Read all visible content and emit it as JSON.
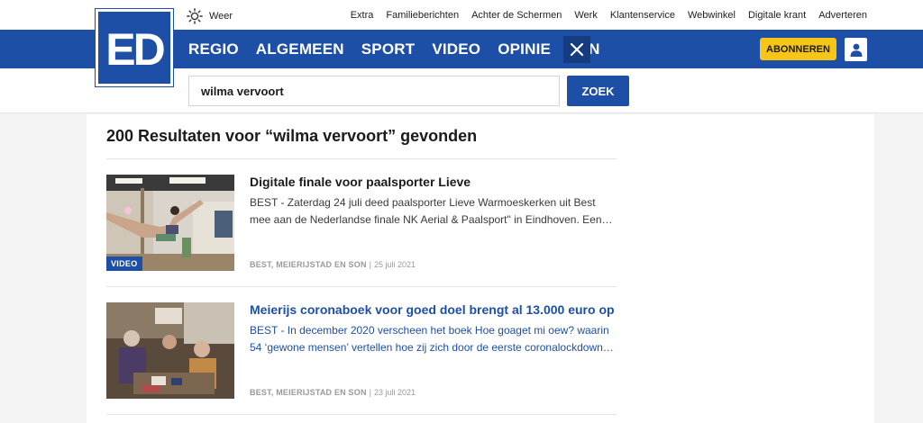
{
  "weather": {
    "label": "Weer",
    "icon": "sun-icon"
  },
  "top_links": [
    "Extra",
    "Familieberichten",
    "Achter de Schermen",
    "Werk",
    "Klantenservice",
    "Webwinkel",
    "Digitale krant",
    "Adverteren"
  ],
  "logo": {
    "text": "ED"
  },
  "nav": {
    "items": [
      "REGIO",
      "ALGEMEEN",
      "SPORT",
      "VIDEO",
      "OPINIE",
      "FUN"
    ],
    "close_icon": "close-icon",
    "subscribe_label": "ABONNEREN",
    "user_icon": "user-icon"
  },
  "search": {
    "value": "wilma vervoort",
    "button_label": "ZOEK"
  },
  "results": {
    "heading": "200 Resultaten voor “wilma vervoort” gevonden",
    "articles": [
      {
        "title": "Digitale finale voor paalsporter Lieve",
        "body": "BEST - Zaterdag 24 juli deed paalsporter Lieve Warmoeskerken uit Best mee aan de Nederlandse finale NK Aerial & Paalsport\" in Eindhoven. Een…",
        "location": "BEST, MEIERIJSTAD EN SON",
        "separator": "|",
        "date": "25 juli 2021",
        "badge": "VIDEO"
      },
      {
        "title": "Meierijs coronaboek voor goed doel brengt al 13.000 euro op",
        "body": "BEST - In december 2020 verscheen het boek Hoe goaget mi oew? waarin 54 ‘gewone mensen’ vertellen hoe zij zich door de eerste coronalockdown…",
        "location": "BEST, MEIERIJSTAD EN SON",
        "separator": "|",
        "date": "23 juli 2021"
      }
    ]
  },
  "colors": {
    "brand_blue": "#1e4fa6",
    "subscribe_yellow": "#f5c518"
  }
}
